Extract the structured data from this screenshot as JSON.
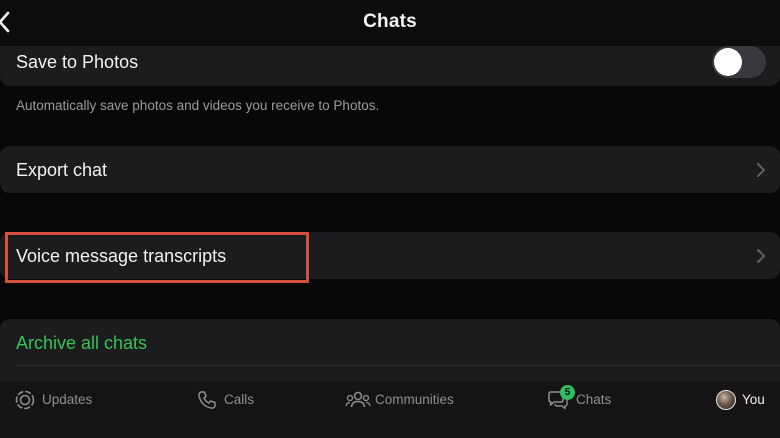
{
  "header": {
    "title": "Chats"
  },
  "settings": {
    "save_to_photos": {
      "label": "Save to Photos",
      "enabled": false,
      "description": "Automatically save photos and videos you receive to Photos."
    },
    "export_chat": {
      "label": "Export chat"
    },
    "voice_transcripts": {
      "label": "Voice message transcripts",
      "highlight_color": "#d9503f"
    },
    "archive_all": {
      "label": "Archive all chats",
      "color": "#35c259"
    }
  },
  "tabbar": {
    "tabs": [
      {
        "label": "Updates",
        "icon": "updates-icon"
      },
      {
        "label": "Calls",
        "icon": "phone-icon"
      },
      {
        "label": "Communities",
        "icon": "communities-icon"
      },
      {
        "label": "Chats",
        "icon": "chat-bubbles-icon",
        "badge": "5"
      },
      {
        "label": "You",
        "icon": "avatar"
      }
    ]
  }
}
